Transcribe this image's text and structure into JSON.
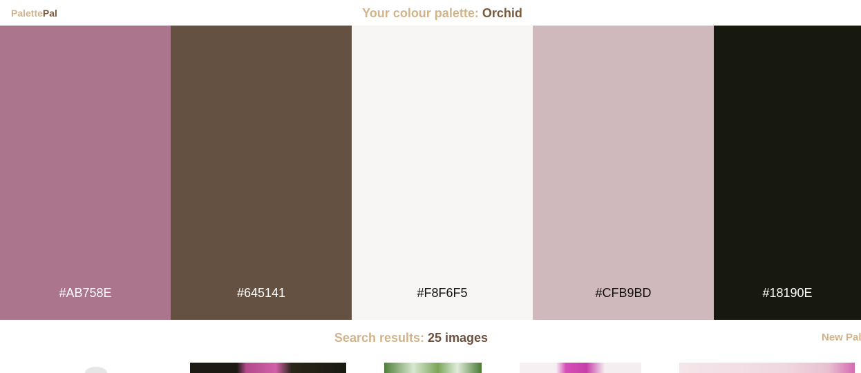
{
  "app": {
    "logo_part1": "Palette",
    "logo_part2": "Pal"
  },
  "header": {
    "title_prefix": "Your colour palette:",
    "palette_name": "Orchid"
  },
  "palette": {
    "swatches": [
      {
        "hex": "#AB758E",
        "color": "#AB758E",
        "text_color": "#ffffff",
        "flex": 247
      },
      {
        "hex": "#645141",
        "color": "#645141",
        "text_color": "#ffffff",
        "flex": 262
      },
      {
        "hex": "#F8F6F5",
        "color": "#F8F6F5",
        "text_color": "#111111",
        "flex": 262
      },
      {
        "hex": "#CFB9BD",
        "color": "#CFB9BD",
        "text_color": "#111111",
        "flex": 262
      },
      {
        "hex": "#18190E",
        "color": "#18190E",
        "text_color": "#ffffff",
        "flex": 213
      }
    ]
  },
  "results": {
    "label": "Search results:",
    "count": "25 images",
    "new_palette_label": "New Palette"
  },
  "thumbnails": [
    {
      "name": "white-orchid"
    },
    {
      "name": "pink-orchid-dark"
    },
    {
      "name": "green-foliage"
    },
    {
      "name": "magenta-orchid"
    },
    {
      "name": "pale-pink-orchid"
    }
  ]
}
